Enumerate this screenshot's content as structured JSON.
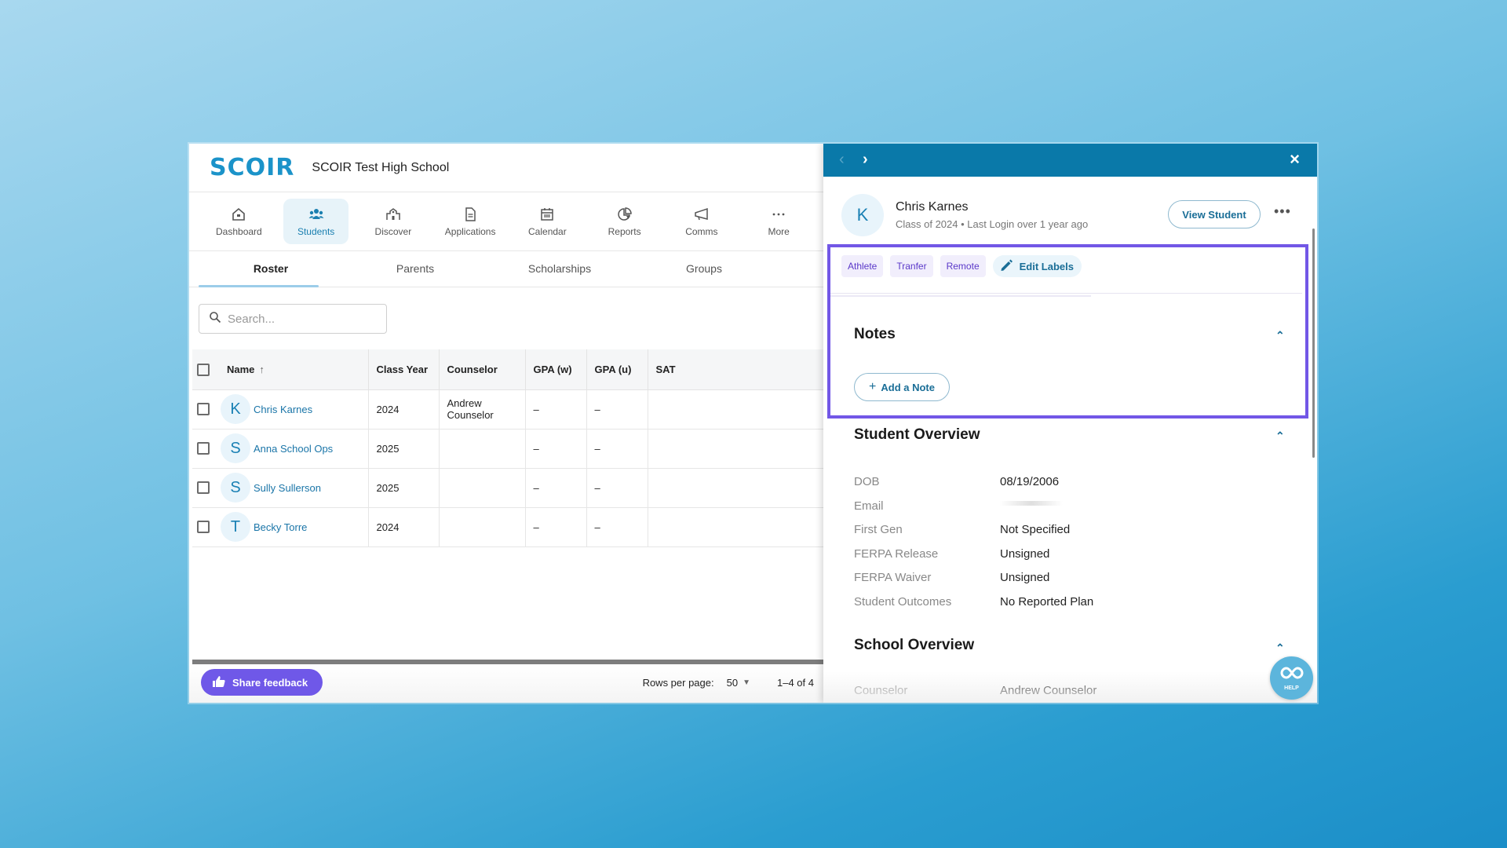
{
  "app": {
    "logo": "SCOIR",
    "school_name": "SCOIR Test High School"
  },
  "nav": {
    "items": [
      {
        "label": "Dashboard",
        "icon": "home-icon",
        "active": false
      },
      {
        "label": "Students",
        "icon": "people-icon",
        "active": true
      },
      {
        "label": "Discover",
        "icon": "college-icon",
        "active": false
      },
      {
        "label": "Applications",
        "icon": "document-icon",
        "active": false
      },
      {
        "label": "Calendar",
        "icon": "calendar-icon",
        "active": false
      },
      {
        "label": "Reports",
        "icon": "pie-chart-icon",
        "active": false
      },
      {
        "label": "Comms",
        "icon": "megaphone-icon",
        "active": false
      },
      {
        "label": "More",
        "icon": "more-horizontal-icon",
        "active": false
      }
    ]
  },
  "tabs": [
    {
      "label": "Roster",
      "active": true
    },
    {
      "label": "Parents",
      "active": false
    },
    {
      "label": "Scholarships",
      "active": false
    },
    {
      "label": "Groups",
      "active": false
    }
  ],
  "search": {
    "placeholder": "Search...",
    "value": ""
  },
  "table": {
    "columns": [
      "Name",
      "Class Year",
      "Counselor",
      "GPA (w)",
      "GPA (u)",
      "SAT"
    ],
    "sort": {
      "column": "Name",
      "direction": "ascending"
    },
    "rows": [
      {
        "initial": "K",
        "name": "Chris Karnes",
        "class_year": "2024",
        "counselor": "Andrew Counselor",
        "gpa_w": "–",
        "gpa_u": "–",
        "sat": ""
      },
      {
        "initial": "S",
        "name": "Anna School Ops",
        "class_year": "2025",
        "counselor": "",
        "gpa_w": "–",
        "gpa_u": "–",
        "sat": ""
      },
      {
        "initial": "S",
        "name": "Sully Sullerson",
        "class_year": "2025",
        "counselor": "",
        "gpa_w": "–",
        "gpa_u": "–",
        "sat": ""
      },
      {
        "initial": "T",
        "name": "Becky Torre",
        "class_year": "2024",
        "counselor": "",
        "gpa_w": "–",
        "gpa_u": "–",
        "sat": ""
      }
    ]
  },
  "footer": {
    "feedback_label": "Share feedback",
    "rows_per_page_label": "Rows per page:",
    "rows_per_page_value": "50",
    "range": "1–4 of 4"
  },
  "drawer": {
    "close_icon": "×",
    "student": {
      "initial": "K",
      "name": "Chris Karnes",
      "subtitle": "Class of 2024 • Last Login over 1 year ago",
      "view_button": "View Student",
      "more_icon": "•••"
    },
    "labels": [
      "Athlete",
      "Tranfer",
      "Remote"
    ],
    "edit_labels": "Edit Labels",
    "notes": {
      "title": "Notes",
      "add_button": "Add a Note"
    },
    "student_overview": {
      "title": "Student Overview",
      "fields": [
        {
          "key": "DOB",
          "value": "08/19/2006"
        },
        {
          "key": "Email",
          "value": ""
        },
        {
          "key": "First Gen",
          "value": "Not Specified"
        },
        {
          "key": "FERPA Release",
          "value": "Unsigned"
        },
        {
          "key": "FERPA Waiver",
          "value": "Unsigned"
        },
        {
          "key": "Student Outcomes",
          "value": "No Reported Plan"
        }
      ]
    },
    "school_overview": {
      "title": "School Overview",
      "fields": [
        {
          "key": "Counselor",
          "value": "Andrew Counselor"
        }
      ]
    }
  },
  "help": {
    "label": "HELP"
  },
  "colors": {
    "brand": "#1b93c9",
    "drawer_header": "#0a79a9",
    "highlight": "#7257e6",
    "feedback_button": "#6f58e8",
    "link": "#1a75a8"
  }
}
